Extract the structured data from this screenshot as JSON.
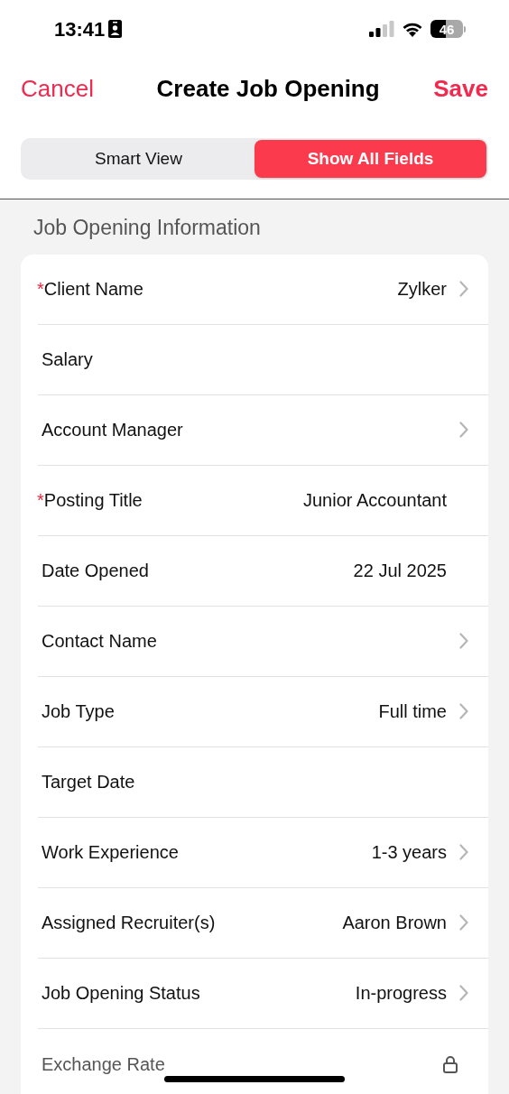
{
  "status_bar": {
    "time": "13:41",
    "battery": "46"
  },
  "nav": {
    "cancel": "Cancel",
    "title": "Create Job Opening",
    "save": "Save"
  },
  "view_tabs": [
    {
      "label": "Smart View",
      "selected": false
    },
    {
      "label": "Show All Fields",
      "selected": true
    }
  ],
  "section": {
    "title": "Job Opening Information",
    "fields": [
      {
        "label": "Client Name",
        "value": "Zylker",
        "required_mark": "*",
        "chevron": true,
        "locked": false
      },
      {
        "label": "Salary",
        "chevron": false,
        "locked": false
      },
      {
        "label": "Account Manager",
        "chevron": true,
        "locked": false
      },
      {
        "label": "Posting Title",
        "value": "Junior Accountant",
        "required_mark": "*",
        "chevron": false,
        "locked": false
      },
      {
        "label": "Date Opened",
        "value": "22 Jul 2025",
        "chevron": false,
        "locked": false
      },
      {
        "label": "Contact Name",
        "chevron": true,
        "locked": false
      },
      {
        "label": "Job Type",
        "value": "Full time",
        "chevron": true,
        "locked": false
      },
      {
        "label": "Target Date",
        "chevron": false,
        "locked": false
      },
      {
        "label": "Work Experience",
        "value": "1-3 years",
        "chevron": true,
        "locked": false
      },
      {
        "label": "Assigned Recruiter(s)",
        "value": "Aaron Brown",
        "chevron": true,
        "locked": false
      },
      {
        "label": "Job Opening Status",
        "value": "In-progress",
        "chevron": true,
        "locked": false
      },
      {
        "label": "Exchange Rate",
        "chevron": false,
        "locked": true
      }
    ]
  }
}
